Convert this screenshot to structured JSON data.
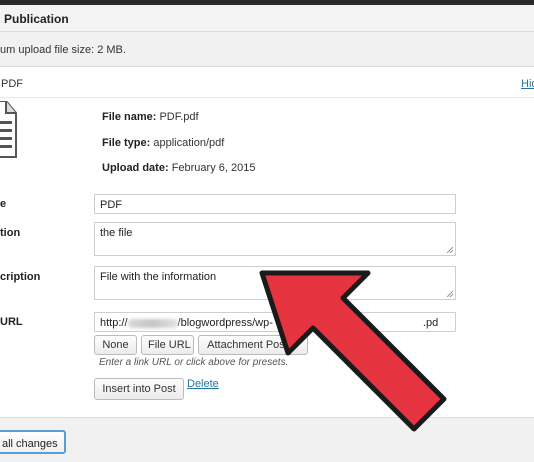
{
  "header": {
    "title": "Publication"
  },
  "upload_note": "um upload file size: 2 MB.",
  "attachment": {
    "name": "PDF",
    "hide_link": "Hid",
    "file_name": {
      "label": "File name:",
      "value": "PDF.pdf"
    },
    "file_type": {
      "label": "File type:",
      "value": "application/pdf"
    },
    "upload_date": {
      "label": "Upload date:",
      "value": "February 6, 2015"
    }
  },
  "fields": {
    "title": {
      "label": "e",
      "value": "PDF"
    },
    "caption": {
      "label": "tion",
      "value": "the file"
    },
    "description": {
      "label": "cription",
      "value": "File with the information"
    },
    "link_url": {
      "label": "URL",
      "value_start": "http://",
      "value_middle": "/blogwordpress/wp-",
      "value_end": ".pd"
    }
  },
  "url_buttons": {
    "none": "None",
    "file_url": "File URL",
    "attachment_post_url": "Attachment Post U"
  },
  "hint": "Enter a link URL or click above for presets.",
  "actions": {
    "insert": "Insert into Post",
    "delete": "Delete",
    "save_all": "all changes"
  },
  "overlay": {
    "arrow_color": "#e5333f",
    "arrow_outline": "#1a1a1a",
    "pointer-icon": "arrow-pointer-icon"
  }
}
